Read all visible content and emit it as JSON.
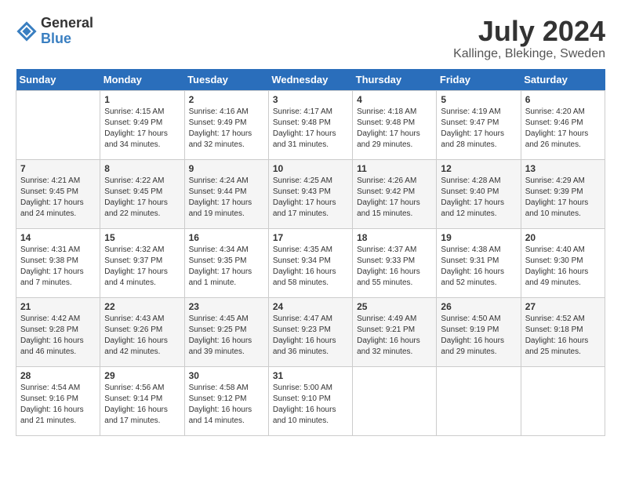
{
  "logo": {
    "general": "General",
    "blue": "Blue"
  },
  "header": {
    "month": "July 2024",
    "location": "Kallinge, Blekinge, Sweden"
  },
  "columns": [
    "Sunday",
    "Monday",
    "Tuesday",
    "Wednesday",
    "Thursday",
    "Friday",
    "Saturday"
  ],
  "weeks": [
    [
      {
        "day": "",
        "sunrise": "",
        "sunset": "",
        "daylight": ""
      },
      {
        "day": "1",
        "sunrise": "Sunrise: 4:15 AM",
        "sunset": "Sunset: 9:49 PM",
        "daylight": "Daylight: 17 hours and 34 minutes."
      },
      {
        "day": "2",
        "sunrise": "Sunrise: 4:16 AM",
        "sunset": "Sunset: 9:49 PM",
        "daylight": "Daylight: 17 hours and 32 minutes."
      },
      {
        "day": "3",
        "sunrise": "Sunrise: 4:17 AM",
        "sunset": "Sunset: 9:48 PM",
        "daylight": "Daylight: 17 hours and 31 minutes."
      },
      {
        "day": "4",
        "sunrise": "Sunrise: 4:18 AM",
        "sunset": "Sunset: 9:48 PM",
        "daylight": "Daylight: 17 hours and 29 minutes."
      },
      {
        "day": "5",
        "sunrise": "Sunrise: 4:19 AM",
        "sunset": "Sunset: 9:47 PM",
        "daylight": "Daylight: 17 hours and 28 minutes."
      },
      {
        "day": "6",
        "sunrise": "Sunrise: 4:20 AM",
        "sunset": "Sunset: 9:46 PM",
        "daylight": "Daylight: 17 hours and 26 minutes."
      }
    ],
    [
      {
        "day": "7",
        "sunrise": "Sunrise: 4:21 AM",
        "sunset": "Sunset: 9:45 PM",
        "daylight": "Daylight: 17 hours and 24 minutes."
      },
      {
        "day": "8",
        "sunrise": "Sunrise: 4:22 AM",
        "sunset": "Sunset: 9:45 PM",
        "daylight": "Daylight: 17 hours and 22 minutes."
      },
      {
        "day": "9",
        "sunrise": "Sunrise: 4:24 AM",
        "sunset": "Sunset: 9:44 PM",
        "daylight": "Daylight: 17 hours and 19 minutes."
      },
      {
        "day": "10",
        "sunrise": "Sunrise: 4:25 AM",
        "sunset": "Sunset: 9:43 PM",
        "daylight": "Daylight: 17 hours and 17 minutes."
      },
      {
        "day": "11",
        "sunrise": "Sunrise: 4:26 AM",
        "sunset": "Sunset: 9:42 PM",
        "daylight": "Daylight: 17 hours and 15 minutes."
      },
      {
        "day": "12",
        "sunrise": "Sunrise: 4:28 AM",
        "sunset": "Sunset: 9:40 PM",
        "daylight": "Daylight: 17 hours and 12 minutes."
      },
      {
        "day": "13",
        "sunrise": "Sunrise: 4:29 AM",
        "sunset": "Sunset: 9:39 PM",
        "daylight": "Daylight: 17 hours and 10 minutes."
      }
    ],
    [
      {
        "day": "14",
        "sunrise": "Sunrise: 4:31 AM",
        "sunset": "Sunset: 9:38 PM",
        "daylight": "Daylight: 17 hours and 7 minutes."
      },
      {
        "day": "15",
        "sunrise": "Sunrise: 4:32 AM",
        "sunset": "Sunset: 9:37 PM",
        "daylight": "Daylight: 17 hours and 4 minutes."
      },
      {
        "day": "16",
        "sunrise": "Sunrise: 4:34 AM",
        "sunset": "Sunset: 9:35 PM",
        "daylight": "Daylight: 17 hours and 1 minute."
      },
      {
        "day": "17",
        "sunrise": "Sunrise: 4:35 AM",
        "sunset": "Sunset: 9:34 PM",
        "daylight": "Daylight: 16 hours and 58 minutes."
      },
      {
        "day": "18",
        "sunrise": "Sunrise: 4:37 AM",
        "sunset": "Sunset: 9:33 PM",
        "daylight": "Daylight: 16 hours and 55 minutes."
      },
      {
        "day": "19",
        "sunrise": "Sunrise: 4:38 AM",
        "sunset": "Sunset: 9:31 PM",
        "daylight": "Daylight: 16 hours and 52 minutes."
      },
      {
        "day": "20",
        "sunrise": "Sunrise: 4:40 AM",
        "sunset": "Sunset: 9:30 PM",
        "daylight": "Daylight: 16 hours and 49 minutes."
      }
    ],
    [
      {
        "day": "21",
        "sunrise": "Sunrise: 4:42 AM",
        "sunset": "Sunset: 9:28 PM",
        "daylight": "Daylight: 16 hours and 46 minutes."
      },
      {
        "day": "22",
        "sunrise": "Sunrise: 4:43 AM",
        "sunset": "Sunset: 9:26 PM",
        "daylight": "Daylight: 16 hours and 42 minutes."
      },
      {
        "day": "23",
        "sunrise": "Sunrise: 4:45 AM",
        "sunset": "Sunset: 9:25 PM",
        "daylight": "Daylight: 16 hours and 39 minutes."
      },
      {
        "day": "24",
        "sunrise": "Sunrise: 4:47 AM",
        "sunset": "Sunset: 9:23 PM",
        "daylight": "Daylight: 16 hours and 36 minutes."
      },
      {
        "day": "25",
        "sunrise": "Sunrise: 4:49 AM",
        "sunset": "Sunset: 9:21 PM",
        "daylight": "Daylight: 16 hours and 32 minutes."
      },
      {
        "day": "26",
        "sunrise": "Sunrise: 4:50 AM",
        "sunset": "Sunset: 9:19 PM",
        "daylight": "Daylight: 16 hours and 29 minutes."
      },
      {
        "day": "27",
        "sunrise": "Sunrise: 4:52 AM",
        "sunset": "Sunset: 9:18 PM",
        "daylight": "Daylight: 16 hours and 25 minutes."
      }
    ],
    [
      {
        "day": "28",
        "sunrise": "Sunrise: 4:54 AM",
        "sunset": "Sunset: 9:16 PM",
        "daylight": "Daylight: 16 hours and 21 minutes."
      },
      {
        "day": "29",
        "sunrise": "Sunrise: 4:56 AM",
        "sunset": "Sunset: 9:14 PM",
        "daylight": "Daylight: 16 hours and 17 minutes."
      },
      {
        "day": "30",
        "sunrise": "Sunrise: 4:58 AM",
        "sunset": "Sunset: 9:12 PM",
        "daylight": "Daylight: 16 hours and 14 minutes."
      },
      {
        "day": "31",
        "sunrise": "Sunrise: 5:00 AM",
        "sunset": "Sunset: 9:10 PM",
        "daylight": "Daylight: 16 hours and 10 minutes."
      },
      {
        "day": "",
        "sunrise": "",
        "sunset": "",
        "daylight": ""
      },
      {
        "day": "",
        "sunrise": "",
        "sunset": "",
        "daylight": ""
      },
      {
        "day": "",
        "sunrise": "",
        "sunset": "",
        "daylight": ""
      }
    ]
  ]
}
